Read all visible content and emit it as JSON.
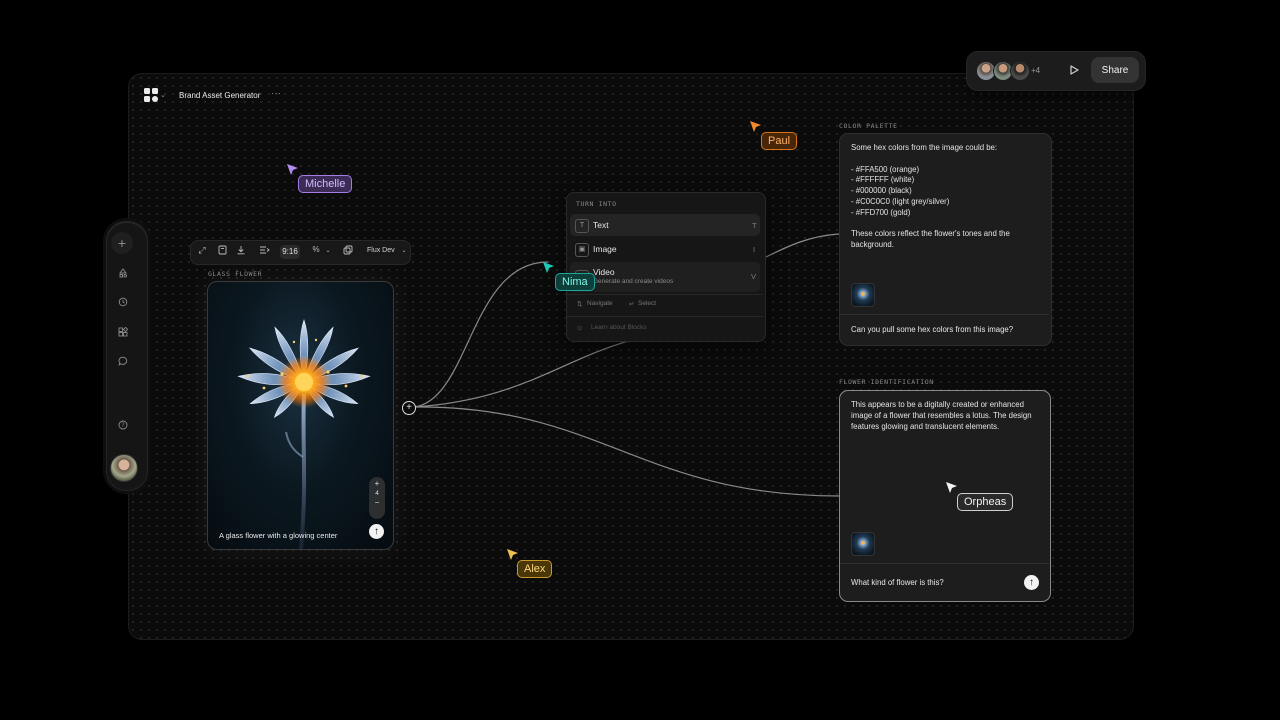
{
  "app": {
    "title": "Brand Asset Generator",
    "more": "···"
  },
  "topbar": {
    "extra_count": "+4",
    "share_label": "Share"
  },
  "sidebar": {
    "items": [
      {
        "icon": "add-icon"
      },
      {
        "icon": "shapes-icon"
      },
      {
        "icon": "history-icon"
      },
      {
        "icon": "blocks-icon"
      },
      {
        "icon": "chat-icon"
      },
      {
        "icon": "help-icon"
      }
    ]
  },
  "image_toolbar": {
    "ratio": "9:16",
    "percent": "%",
    "model": "Flux Dev"
  },
  "image_card": {
    "label": "GLASS FLOWER",
    "caption": "A glass flower with a glowing center",
    "zoom_plus": "+",
    "zoom_value": "4",
    "zoom_minus": "−"
  },
  "turn_into_menu": {
    "header": "TURN INTO",
    "items": [
      {
        "label": "Text",
        "key": "T",
        "icon": "text-icon"
      },
      {
        "label": "Image",
        "key": "I",
        "icon": "image-icon"
      },
      {
        "label": "Video",
        "sub": "Generate and create videos",
        "key": "V",
        "icon": "video-icon"
      }
    ],
    "navigate": "Navigate",
    "select": "Select",
    "learn": "Learn about Blocks"
  },
  "color_palette": {
    "label": "COLOR PALETTE",
    "response": "Some hex colors from the image could be:\n\n- #FFA500 (orange)\n- #FFFFFF (white)\n- #000000 (black)\n- #C0C0C0 (light grey/silver)\n- #FFD700 (gold)\n\nThese colors reflect the flower's tones and the background.",
    "prompt": "Can you pull some hex colors from this image?"
  },
  "flower_id": {
    "label": "FLOWER IDENTIFICATION",
    "response": "This appears to be a digitally created or enhanced image of a flower that resembles a lotus. The design features glowing and translucent elements.",
    "prompt": "What kind of flower is this?"
  },
  "cursors": [
    {
      "name": "Michelle",
      "color": "#b48cf0"
    },
    {
      "name": "Paul",
      "color": "#f08a2a"
    },
    {
      "name": "Nima",
      "color": "#1fc9b7"
    },
    {
      "name": "Alex",
      "color": "#f0c050"
    },
    {
      "name": "Orpheas",
      "color": "#f2f2f2"
    }
  ]
}
